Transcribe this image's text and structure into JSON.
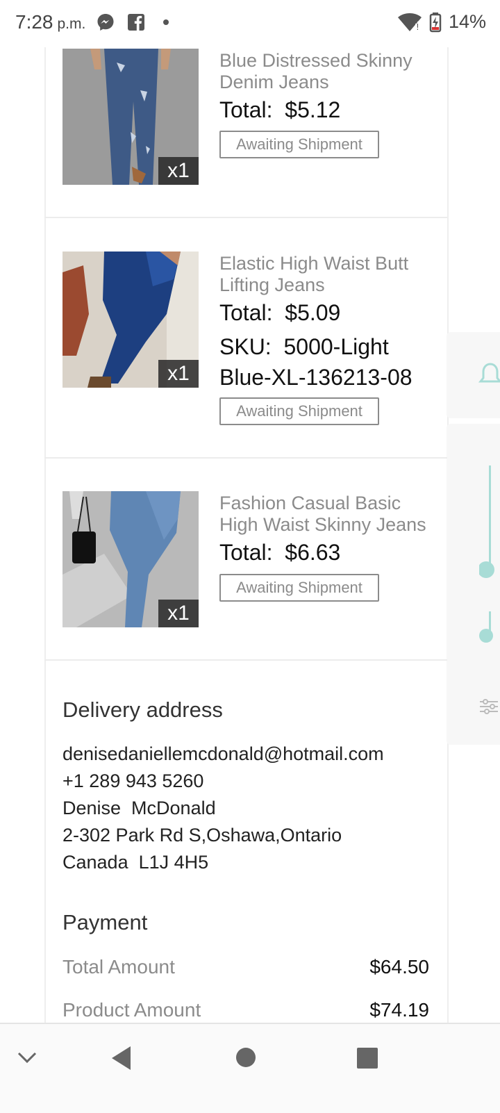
{
  "status": {
    "time": "7:28",
    "ampm": "p.m.",
    "battery": "14%"
  },
  "items": [
    {
      "title": "Blue Distressed Skinny Denim Jeans",
      "total_label": "Total:",
      "total": "$5.12",
      "status": "Awaiting Shipment",
      "qty": "x1"
    },
    {
      "title": "Elastic High Waist Butt Lifting Jeans",
      "total_label": "Total:",
      "total": "$5.09",
      "sku_label": "SKU:",
      "sku": "5000-Light Blue-XL-136213-08",
      "status": "Awaiting Shipment",
      "qty": "x1"
    },
    {
      "title": "Fashion Casual Basic High Waist Skinny Jeans",
      "total_label": "Total:",
      "total": "$6.63",
      "status": "Awaiting Shipment",
      "qty": "x1"
    }
  ],
  "delivery": {
    "title": "Delivery address",
    "email": "denisedaniellemcdonald@hotmail.com",
    "phone": "+1 289 943 5260",
    "name": "Denise  McDonald",
    "street": "2-302 Park Rd S,Oshawa,Ontario",
    "country_postal": "Canada  L1J 4H5"
  },
  "payment": {
    "title": "Payment",
    "rows": [
      {
        "label": "Total Amount",
        "value": "$64.50"
      },
      {
        "label": "Product Amount",
        "value": "$74.19"
      }
    ]
  },
  "colors": {
    "accent_teal": "#a8dcd6",
    "badge_gray": "#8b8b8b"
  }
}
